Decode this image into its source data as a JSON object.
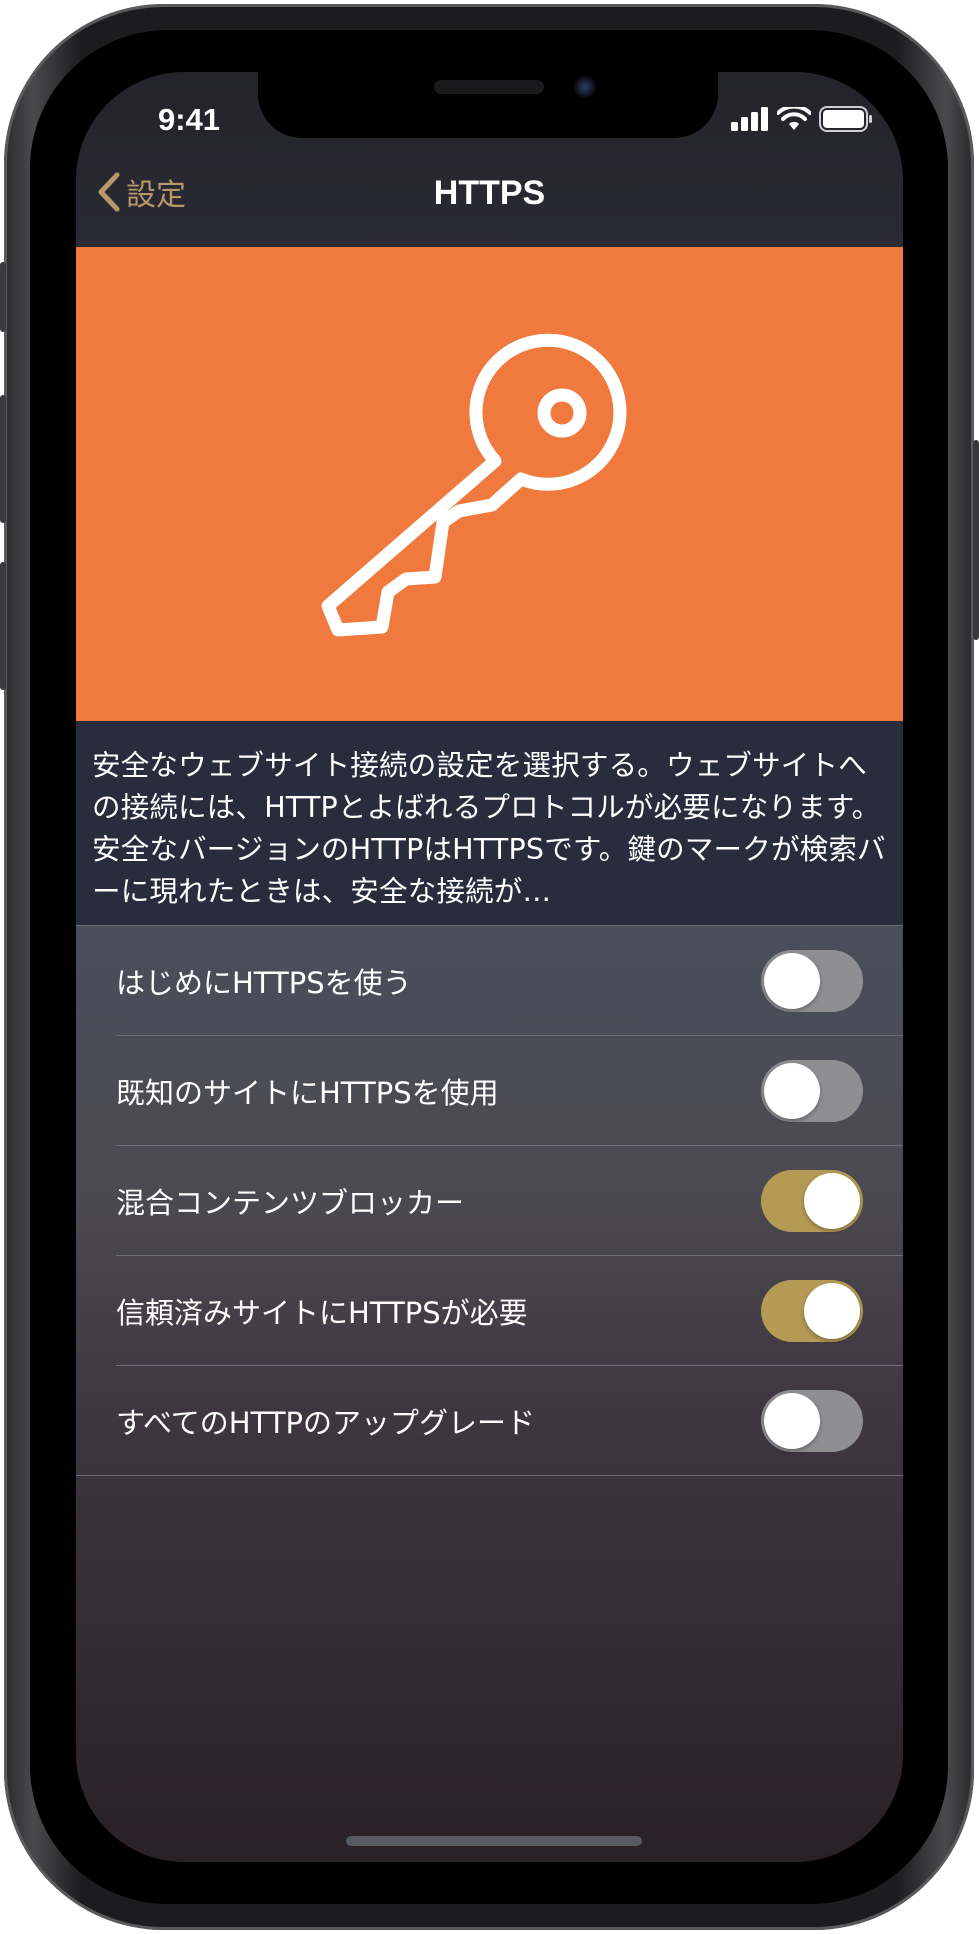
{
  "status_bar": {
    "time": "9:41",
    "icons": [
      "cellular-signal-icon",
      "wifi-icon",
      "battery-icon"
    ]
  },
  "nav": {
    "back_label": "設定",
    "title": "HTTPS"
  },
  "banner": {
    "icon": "key-icon",
    "color": "#f07a3e"
  },
  "description": "安全なウェブサイト接続の設定を選択する。ウェブサイトへの接続には、HTTPとよばれるプロトコルが必要になります。安全なバージョンのHTTPはHTTPSです。鍵のマークが検索バーに現れたときは、安全な接続が…",
  "settings": [
    {
      "label": "はじめにHTTPSを使う",
      "enabled": false
    },
    {
      "label": "既知のサイトにHTTPSを使用",
      "enabled": false
    },
    {
      "label": "混合コンテンツブロッカー",
      "enabled": true
    },
    {
      "label": "信頼済みサイトにHTTPSが必要",
      "enabled": true
    },
    {
      "label": "すべてのHTTPのアップグレード",
      "enabled": false
    }
  ],
  "colors": {
    "accent": "#b8976a",
    "toggle_on": "#b59a55",
    "toggle_off": "#8e8e93"
  }
}
